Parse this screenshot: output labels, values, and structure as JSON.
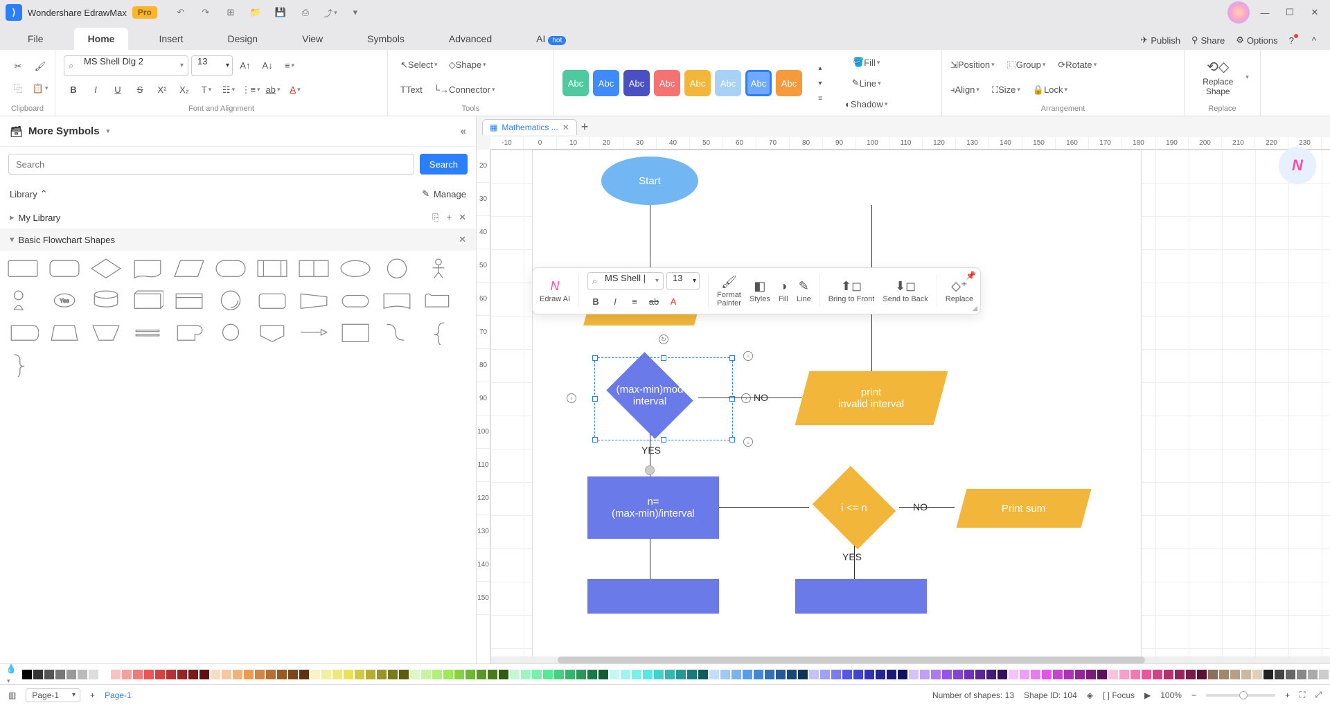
{
  "app": {
    "title": "Wondershare EdrawMax",
    "pro": "Pro"
  },
  "menu": {
    "tabs": [
      "File",
      "Home",
      "Insert",
      "Design",
      "View",
      "Symbols",
      "Advanced",
      "AI"
    ],
    "active": 1,
    "hot": "hot",
    "publish": "Publish",
    "share": "Share",
    "options": "Options"
  },
  "ribbon": {
    "clipboard": "Clipboard",
    "font_name": "MS Shell Dlg 2",
    "font_size": "13",
    "font_align": "Font and Alignment",
    "select": "Select",
    "text": "Text",
    "shape": "Shape",
    "connector": "Connector",
    "tools": "Tools",
    "swatch_label": "Abc",
    "styles": "Styles",
    "fill": "Fill",
    "line": "Line",
    "shadow": "Shadow",
    "position": "Position",
    "align": "Align",
    "group": "Group",
    "size": "Size",
    "rotate": "Rotate",
    "lock": "Lock",
    "arrangement": "Arrangement",
    "replace_shape": "Replace\nShape",
    "replace": "Replace",
    "swatch_colors": [
      "#4fc9a0",
      "#3d8bff",
      "#4a4fc1",
      "#f47272",
      "#f2b73a",
      "#a8d2f5",
      "#6fa8ff",
      "#f59a3d"
    ],
    "swatch_selected": 6
  },
  "sidebar": {
    "title": "More Symbols",
    "search_placeholder": "Search",
    "search_btn": "Search",
    "library": "Library",
    "manage": "Manage",
    "my_library": "My Library",
    "section": "Basic Flowchart Shapes"
  },
  "doc": {
    "tab_name": "Mathematics ..."
  },
  "hruler": [
    "-10",
    "0",
    "10",
    "20",
    "30",
    "40",
    "50",
    "60",
    "70",
    "80",
    "90",
    "100",
    "110",
    "120",
    "130",
    "140",
    "150",
    "160",
    "170",
    "180",
    "190",
    "200",
    "210",
    "220",
    "230"
  ],
  "vruler": [
    "20",
    "30",
    "40",
    "50",
    "60",
    "70",
    "80",
    "90",
    "100",
    "110",
    "120",
    "130",
    "140",
    "150"
  ],
  "flow": {
    "start": "Start",
    "decision1": "(max-min)mod\ninterval",
    "print_invalid": "print\ninvalid interval",
    "n_eq": "n=\n(max-min)/interval",
    "i_le_n": "i <= n",
    "print_sum": "Print sum",
    "yes": "YES",
    "no": "NO",
    "no2": "NO",
    "yes2": "YES"
  },
  "float": {
    "edraw_ai": "Edraw AI",
    "font": "MS Shell |",
    "size": "13",
    "format_painter": "Format\nPainter",
    "styles": "Styles",
    "fill": "Fill",
    "line": "Line",
    "bring_front": "Bring to Front",
    "send_back": "Send to Back",
    "replace": "Replace"
  },
  "colorbar_hues": [
    "#000",
    "#333",
    "#555",
    "#777",
    "#999",
    "#bbb",
    "#ddd",
    "#fff",
    "#f8c3c3",
    "#f4a0a0",
    "#ef7b7b",
    "#ea5555",
    "#d24343",
    "#b63232",
    "#982525",
    "#7a1a1a",
    "#5c1010",
    "#f8ddc3",
    "#f4c8a0",
    "#efb27b",
    "#ea9c55",
    "#d28643",
    "#b66f32",
    "#985a25",
    "#7a461a",
    "#5c3310",
    "#f8f4c3",
    "#f4eea0",
    "#efe87b",
    "#eae155",
    "#d2c943",
    "#b6ae32",
    "#989425",
    "#7a7a1a",
    "#5c5c10",
    "#def8c3",
    "#c8f4a0",
    "#b2ef7b",
    "#9cea55",
    "#86d243",
    "#6fb632",
    "#5a9825",
    "#467a1a",
    "#335c10",
    "#c3f8d4",
    "#a0f4c0",
    "#7befab",
    "#55ea96",
    "#43d282",
    "#32b66d",
    "#25985a",
    "#1a7a46",
    "#105c33",
    "#c3f8f4",
    "#a0f4ee",
    "#7befe8",
    "#55eae1",
    "#43d2c9",
    "#32b6ae",
    "#259894",
    "#1a7a7a",
    "#105c5c",
    "#c3def8",
    "#a0c8f4",
    "#7bb2ef",
    "#559cea",
    "#4386d2",
    "#326fb6",
    "#255a98",
    "#1a467a",
    "#10335c",
    "#c3c3f8",
    "#a0a0f4",
    "#7b7bef",
    "#5555ea",
    "#4343d2",
    "#3232b6",
    "#252598",
    "#1a1a7a",
    "#10105c",
    "#d4c3f8",
    "#c0a0f4",
    "#ab7bef",
    "#9655ea",
    "#8243d2",
    "#6d32b6",
    "#5a2598",
    "#461a7a",
    "#33105c",
    "#f4c3f8",
    "#eea0f4",
    "#e87bef",
    "#e155ea",
    "#c943d2",
    "#ae32b6",
    "#942598",
    "#7a1a7a",
    "#5c105c",
    "#f8c3dd",
    "#f4a0c8",
    "#ef7bb2",
    "#ea559c",
    "#d24386",
    "#b6326f",
    "#98255a",
    "#7a1a46",
    "#5c1033",
    "#8b6f5a",
    "#a0876f",
    "#b69f87",
    "#ccb79f",
    "#e1cfb7",
    "#222",
    "#444",
    "#666",
    "#888",
    "#aaa",
    "#ccc",
    "#e5e5e5",
    "#f2f2f2"
  ],
  "status": {
    "page_select": "Page-1",
    "page_link": "Page-1",
    "shapes_count": "Number of shapes: 13",
    "shape_id": "Shape ID: 104",
    "focus": "Focus",
    "zoom": "100%"
  }
}
